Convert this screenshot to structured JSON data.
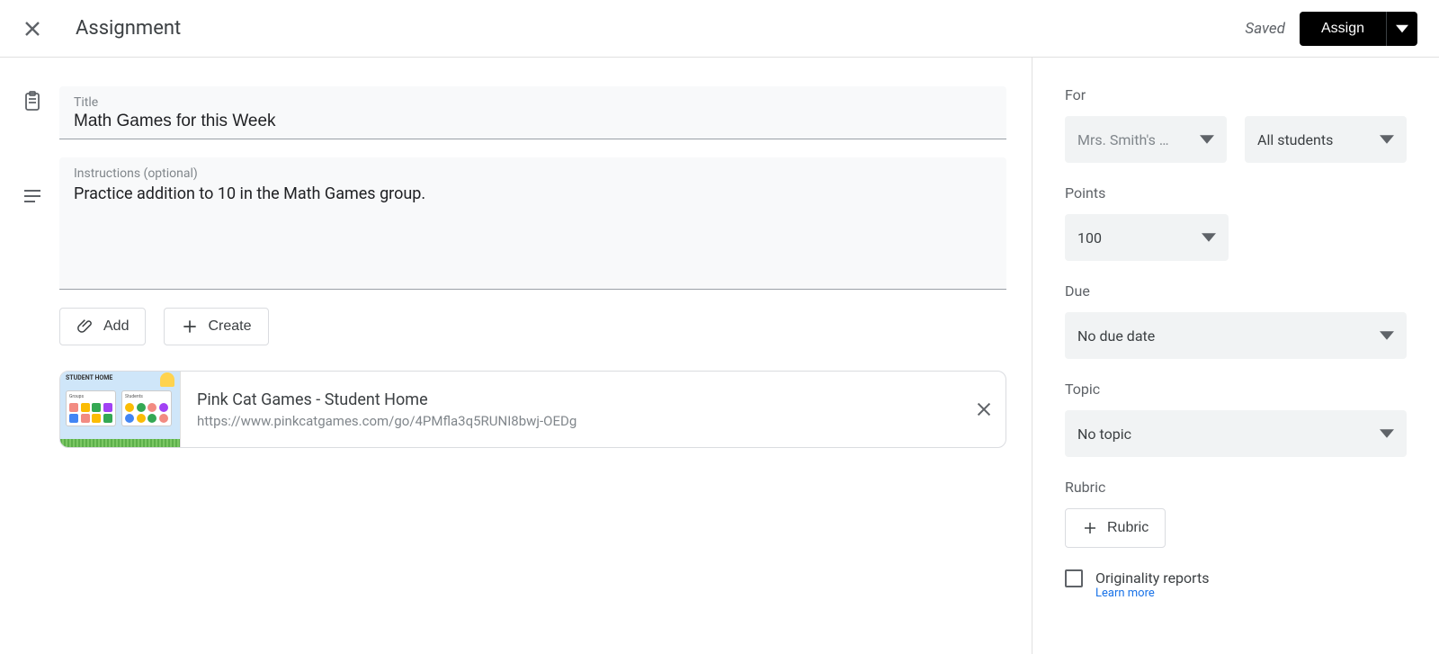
{
  "header": {
    "title": "Assignment",
    "saved": "Saved",
    "assign": "Assign"
  },
  "title_field": {
    "label": "Title",
    "value": "Math Games for this Week"
  },
  "instructions_field": {
    "label": "Instructions (optional)",
    "value": "Practice addition to 10 in the Math Games group."
  },
  "actions": {
    "add": "Add",
    "create": "Create"
  },
  "attachment": {
    "title": "Pink Cat Games - Student Home",
    "url": "https://www.pinkcatgames.com/go/4PMfla3q5RUNI8bwj-OEDg",
    "thumb": {
      "header": "STUDENT HOME",
      "card1": "Groups",
      "card2": "Students"
    }
  },
  "sidebar": {
    "for": {
      "label": "For",
      "class_val": "Mrs. Smith's …",
      "students_val": "All students"
    },
    "points": {
      "label": "Points",
      "value": "100"
    },
    "due": {
      "label": "Due",
      "value": "No due date"
    },
    "topic": {
      "label": "Topic",
      "value": "No topic"
    },
    "rubric": {
      "label": "Rubric",
      "button": "Rubric"
    },
    "originality": {
      "label": "Originality reports",
      "learn": "Learn more"
    }
  }
}
